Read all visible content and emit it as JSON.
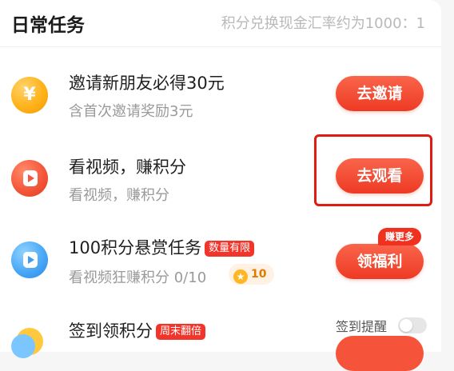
{
  "header": {
    "title": "日常任务",
    "exchange_rate": "积分兑换现金汇率约为1000：1"
  },
  "tasks": [
    {
      "title": "邀请新朋友必得30元",
      "subtitle": "含首次邀请奖励3元",
      "icon": "yen-coin-icon",
      "icon_text": "¥",
      "button": "去邀请"
    },
    {
      "title": "看视频，赚积分",
      "subtitle": "看视频，赚积分",
      "icon": "red-play-icon",
      "button": "去观看"
    },
    {
      "title": "100积分悬赏任务",
      "tag": "数量有限",
      "subtitle": "看视频狂赚积分 0/10",
      "points": "10",
      "icon": "blue-play-icon",
      "badge": "赚更多",
      "button": "领福利"
    },
    {
      "title": "签到领积分",
      "tag": "周末翻倍",
      "reminder_label": "签到提醒",
      "reminder_enabled": false,
      "icon": "checkin-icon"
    }
  ],
  "colors": {
    "accent": "#ee3a24",
    "highlight_box": "#e01b10",
    "tag": "#f2352a"
  }
}
